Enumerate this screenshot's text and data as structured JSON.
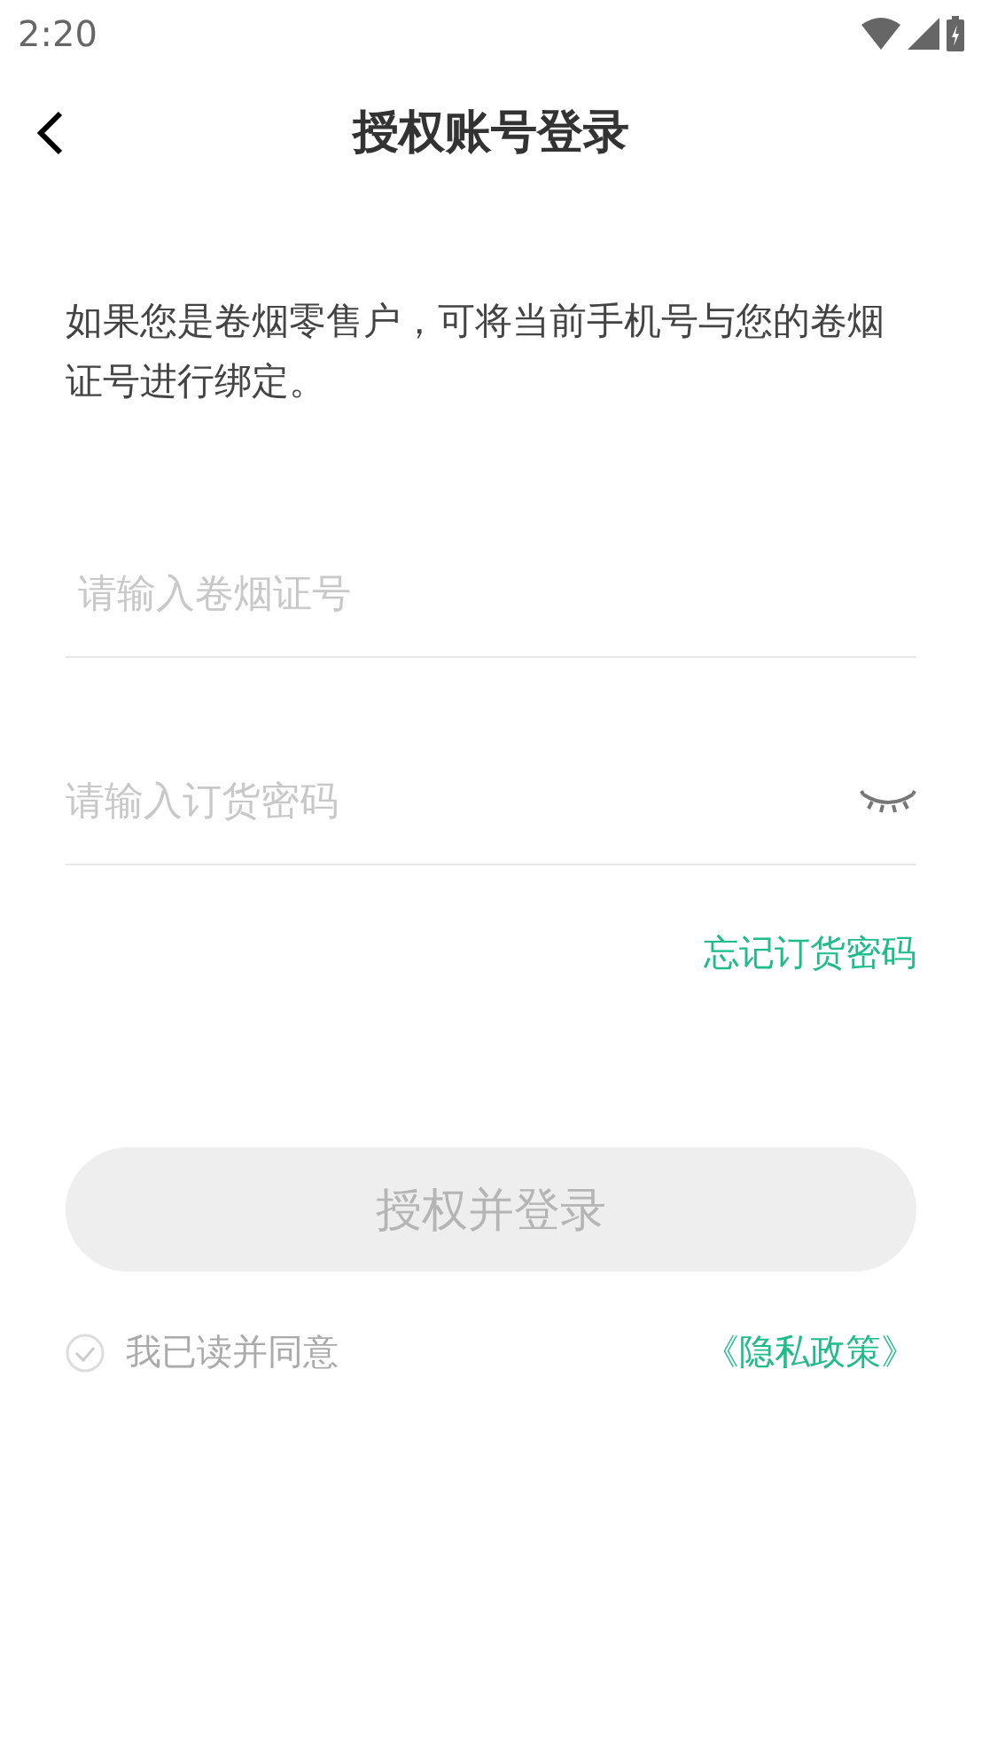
{
  "status_bar": {
    "time": "2:20"
  },
  "nav": {
    "title": "授权账号登录"
  },
  "intro": "如果您是卷烟零售户，可将当前手机号与您的卷烟证号进行绑定。",
  "fields": [
    {
      "kind": "text",
      "placeholder": "请输入卷烟证号"
    },
    {
      "kind": "password",
      "placeholder": "请输入订货密码",
      "revealed": false
    }
  ],
  "forgot_link": "忘记订货密码",
  "submit": {
    "label": "授权并登录",
    "disabled": true
  },
  "agreement": {
    "label": "我已读并同意",
    "checked": false,
    "link": "《隐私政策》"
  }
}
